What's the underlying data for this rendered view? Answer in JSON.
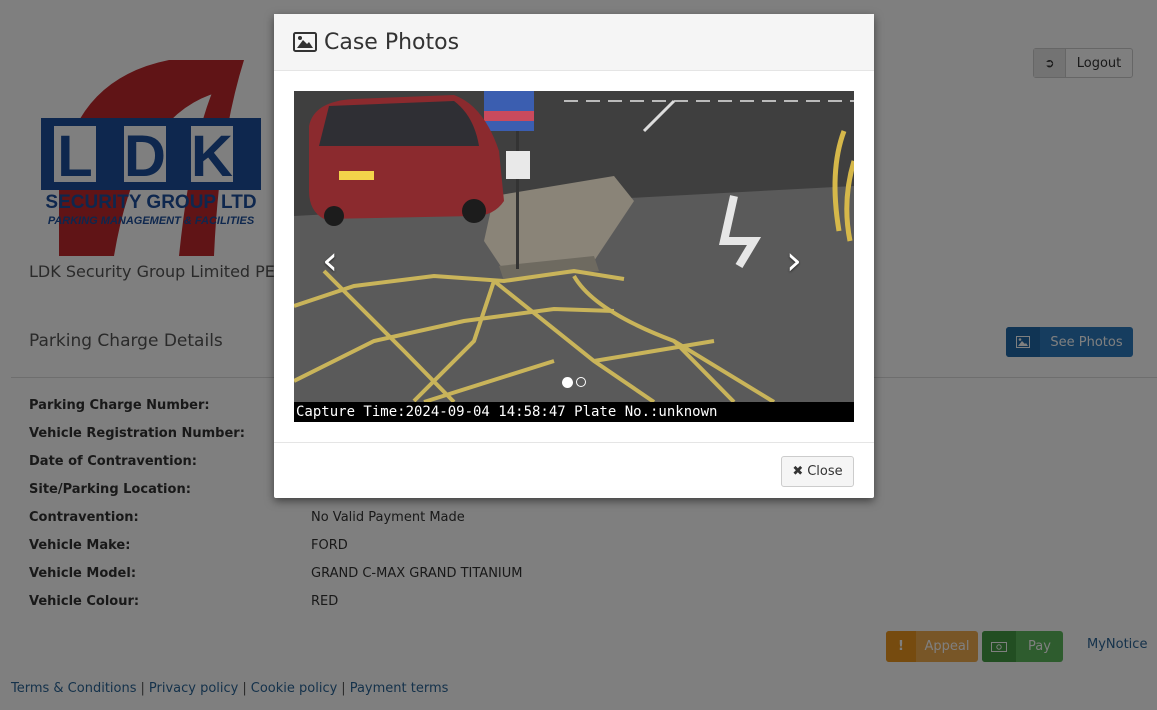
{
  "header": {
    "company_name": "LDK Security Group Limited PE",
    "logout_label": "Logout"
  },
  "logo": {
    "line1": "L D K",
    "line2": "SECURITY GROUP LTD",
    "line3": "PARKING MANAGEMENT & FACILITIES"
  },
  "section": {
    "title": "Parking Charge Details",
    "see_photos_label": "See Photos"
  },
  "details": [
    {
      "label": "Parking Charge Number:",
      "value": ""
    },
    {
      "label": "Vehicle Registration Number:",
      "value": ""
    },
    {
      "label": "Date of Contravention:",
      "value": ""
    },
    {
      "label": "Site/Parking Location:",
      "value": ""
    },
    {
      "label": "Contravention:",
      "value": "No Valid Payment Made"
    },
    {
      "label": "Vehicle Make:",
      "value": "FORD"
    },
    {
      "label": "Vehicle Model:",
      "value": "GRAND C-MAX GRAND TITANIUM"
    },
    {
      "label": "Vehicle Colour:",
      "value": "RED"
    }
  ],
  "actions": {
    "appeal_label": "Appeal",
    "pay_label": "Pay",
    "mynotice_label": "MyNotice"
  },
  "footer": {
    "links": [
      "Terms & Conditions",
      "Privacy policy",
      "Cookie policy",
      "Payment terms"
    ]
  },
  "modal": {
    "title": "Case Photos",
    "caption": "Capture Time:2024-09-04 14:58:47 Plate No.:unknown",
    "close_label": "Close",
    "slide_count": 2,
    "active_slide": 1
  },
  "colors": {
    "primary": "#2c7bbf",
    "appeal": "#f0ad4e",
    "pay": "#5cb85c",
    "link": "#2a6496",
    "logo_blue": "#1c4f9c",
    "logo_red": "#c0282d"
  }
}
